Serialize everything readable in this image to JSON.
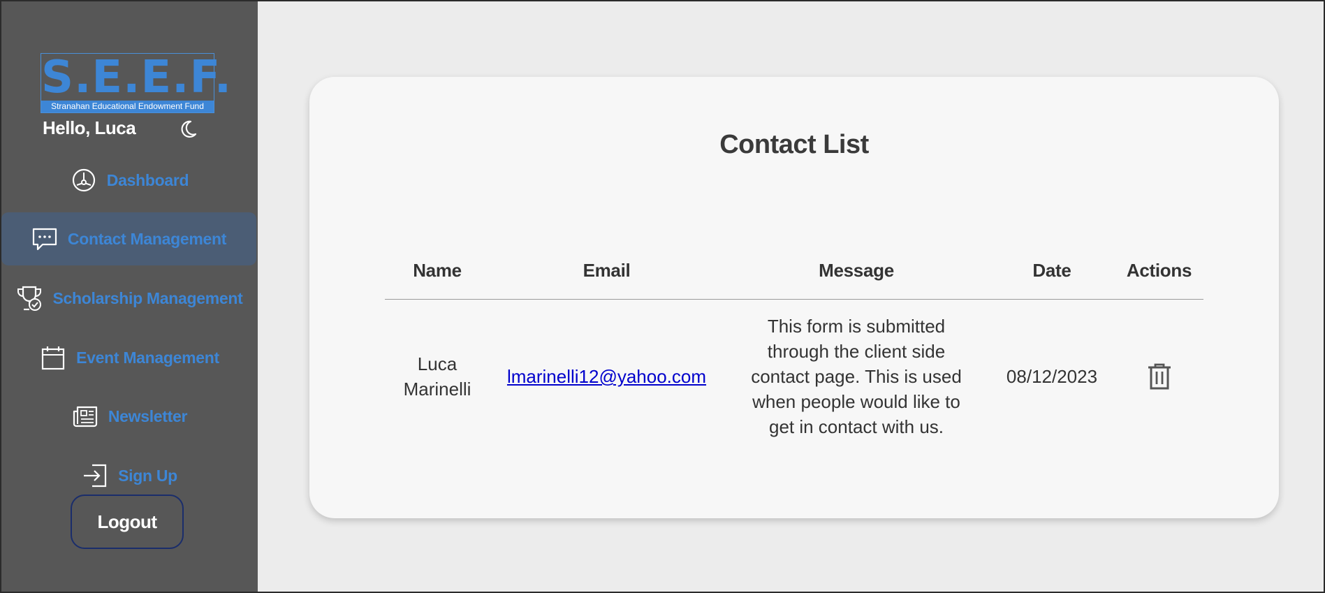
{
  "brand": {
    "logo_main": "S.E.E.F.",
    "logo_sub": "Stranahan Educational Endowment Fund"
  },
  "user": {
    "greeting": "Hello, Luca"
  },
  "sidebar": {
    "items": [
      {
        "label": "Dashboard",
        "icon": "dashboard-icon"
      },
      {
        "label": "Contact Management",
        "icon": "chat-icon",
        "active": true
      },
      {
        "label": "Scholarship Management",
        "icon": "trophy-icon"
      },
      {
        "label": "Event Management",
        "icon": "calendar-icon"
      },
      {
        "label": "Newsletter",
        "icon": "newspaper-icon"
      },
      {
        "label": "Sign Up",
        "icon": "sign-in-icon"
      }
    ],
    "logout_label": "Logout"
  },
  "main": {
    "title": "Contact List",
    "table": {
      "headers": [
        "Name",
        "Email",
        "Message",
        "Date",
        "Actions"
      ],
      "rows": [
        {
          "name": "Luca Marinelli",
          "email": "lmarinelli12@yahoo.com",
          "message": "This form is submitted through the client side contact page. This is used when people would like to get in contact with us.",
          "date": "08/12/2023",
          "action_icon": "trash-icon"
        }
      ]
    }
  },
  "colors": {
    "accent": "#3d86d6",
    "sidebar_bg": "#575757",
    "active_bg": "#4b5d75",
    "page_bg": "#ececec",
    "card_bg": "#f7f7f7"
  }
}
